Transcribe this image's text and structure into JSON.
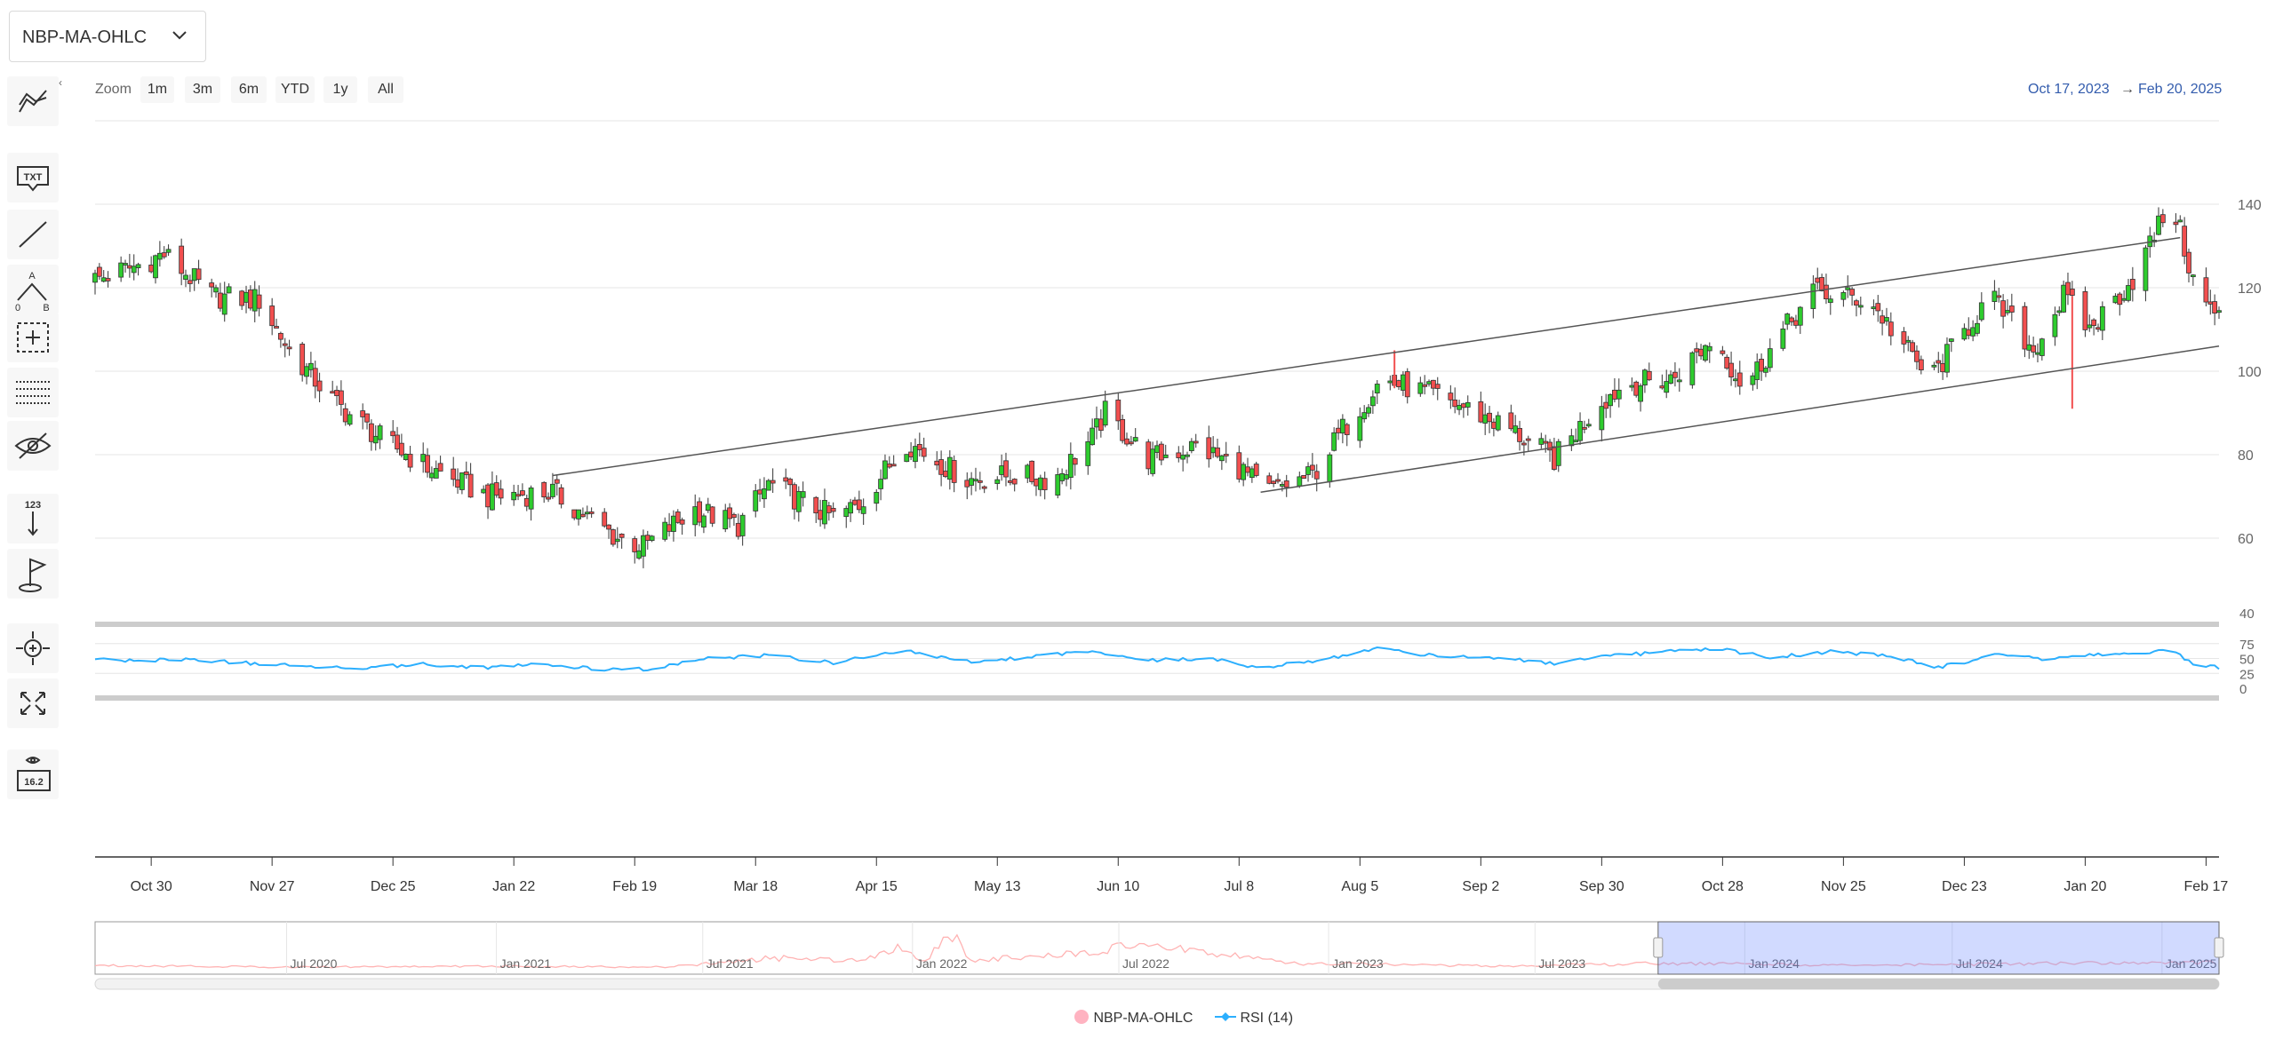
{
  "selector": {
    "value": "NBP-MA-OHLC"
  },
  "toolbar": {
    "collapse_glyph": "‹",
    "tools": [
      {
        "name": "indicators-icon"
      },
      {
        "name": "text-annotation-icon",
        "text": "TXT"
      },
      {
        "name": "line-tool-icon"
      },
      {
        "name": "elliott-wave-icon",
        "texts": [
          "A",
          "0",
          "B"
        ]
      },
      {
        "name": "crosshair-measure-icon"
      },
      {
        "name": "fibonacci-retracement-icon"
      },
      {
        "name": "hide-drawings-icon"
      },
      {
        "name": "vertical-counter-icon",
        "text": "123"
      },
      {
        "name": "flag-icon"
      },
      {
        "name": "zoom-change-icon"
      },
      {
        "name": "fullscreen-icon"
      },
      {
        "name": "current-price-icon",
        "text": "16.2"
      }
    ]
  },
  "zoom": {
    "label": "Zoom",
    "buttons": [
      "1m",
      "3m",
      "6m",
      "YTD",
      "1y",
      "All"
    ]
  },
  "range": {
    "from": "Oct 17, 2023",
    "arrow": "→",
    "to": "Feb 20, 2025"
  },
  "legend": {
    "ohlc": "NBP-MA-OHLC",
    "rsi": "RSI (14)"
  },
  "colors": {
    "up": "#2ecc2e",
    "down": "#f24f4f",
    "rsi": "#2caffe",
    "navigator_line": "#ffb3b3",
    "navigator_mask": "rgba(102,133,255,0.3)",
    "range_text": "#335cad"
  },
  "chart_data": [
    {
      "type": "candlestick",
      "x_ticks": [
        "Oct 30",
        "Nov 27",
        "Dec 25",
        "Jan 22",
        "Feb 19",
        "Mar 18",
        "Apr 15",
        "May 13",
        "Jun 10",
        "Jul 8",
        "Aug 5",
        "Sep 2",
        "Sep 30",
        "Oct 28",
        "Nov 25",
        "Dec 23",
        "Jan 20",
        "Feb 17"
      ],
      "y_ticks": [
        60,
        80,
        100,
        120,
        140
      ],
      "ylim": [
        40,
        160
      ],
      "x_range": [
        "2023-10-17",
        "2025-02-20"
      ],
      "close_path": [
        [
          "2023-10-17",
          122
        ],
        [
          "2023-10-26",
          125
        ],
        [
          "2023-11-02",
          128
        ],
        [
          "2023-11-13",
          118
        ],
        [
          "2023-11-24",
          117
        ],
        [
          "2023-12-01",
          105
        ],
        [
          "2023-12-12",
          92
        ],
        [
          "2023-12-22",
          84
        ],
        [
          "2024-01-02",
          77
        ],
        [
          "2024-01-16",
          70
        ],
        [
          "2024-01-31",
          71
        ],
        [
          "2024-02-15",
          60
        ],
        [
          "2024-02-21",
          58
        ],
        [
          "2024-03-04",
          67
        ],
        [
          "2024-03-14",
          63
        ],
        [
          "2024-03-21",
          73
        ],
        [
          "2024-04-05",
          65
        ],
        [
          "2024-04-11",
          68
        ],
        [
          "2024-04-22",
          83
        ],
        [
          "2024-05-06",
          74
        ],
        [
          "2024-05-16",
          75
        ],
        [
          "2024-05-26",
          74
        ],
        [
          "2024-06-04",
          84
        ],
        [
          "2024-06-07",
          90
        ],
        [
          "2024-06-17",
          79
        ],
        [
          "2024-06-28",
          82
        ],
        [
          "2024-07-08",
          77
        ],
        [
          "2024-07-14",
          71
        ],
        [
          "2024-07-25",
          75
        ],
        [
          "2024-08-01",
          86
        ],
        [
          "2024-08-10",
          98
        ],
        [
          "2024-08-20",
          95
        ],
        [
          "2024-08-30",
          91
        ],
        [
          "2024-09-09",
          86
        ],
        [
          "2024-09-19",
          79
        ],
        [
          "2024-09-30",
          93
        ],
        [
          "2024-10-06",
          97
        ],
        [
          "2024-10-16",
          98
        ],
        [
          "2024-10-26",
          108
        ],
        [
          "2024-11-02",
          96
        ],
        [
          "2024-11-10",
          108
        ],
        [
          "2024-11-18",
          119
        ],
        [
          "2024-12-01",
          117
        ],
        [
          "2024-12-15",
          98
        ],
        [
          "2024-12-29",
          118
        ],
        [
          "2025-01-08",
          105
        ],
        [
          "2025-01-15",
          118
        ],
        [
          "2025-01-21",
          110
        ],
        [
          "2025-01-31",
          122
        ],
        [
          "2025-02-09",
          141
        ],
        [
          "2025-02-15",
          118
        ],
        [
          "2025-02-20",
          113
        ]
      ],
      "trend_channel": {
        "upper": [
          [
            "2024-01-31",
            75
          ],
          [
            "2025-02-11",
            132
          ]
        ],
        "lower": [
          [
            "2024-07-13",
            71
          ],
          [
            "2025-02-20",
            106
          ]
        ]
      },
      "outlier_wicks": [
        {
          "date": "2024-08-13",
          "high": 105,
          "low": 96
        },
        {
          "date": "2025-01-17",
          "high": 118,
          "low": 91
        }
      ]
    },
    {
      "type": "line",
      "series": [
        {
          "name": "RSI (14)",
          "ylim": [
            0,
            100
          ],
          "y_ticks": [
            0,
            25,
            50,
            75,
            40
          ]
        }
      ],
      "rsi_path": [
        [
          "2023-10-17",
          48
        ],
        [
          "2023-10-27",
          46
        ],
        [
          "2023-11-06",
          49
        ],
        [
          "2023-11-17",
          44
        ],
        [
          "2023-12-01",
          38
        ],
        [
          "2023-12-15",
          34
        ],
        [
          "2024-01-01",
          40
        ],
        [
          "2024-01-15",
          35
        ],
        [
          "2024-01-29",
          40
        ],
        [
          "2024-02-12",
          31
        ],
        [
          "2024-02-22",
          32
        ],
        [
          "2024-03-07",
          50
        ],
        [
          "2024-03-21",
          55
        ],
        [
          "2024-04-05",
          43
        ],
        [
          "2024-04-21",
          63
        ],
        [
          "2024-05-06",
          45
        ],
        [
          "2024-05-20",
          52
        ],
        [
          "2024-06-03",
          63
        ],
        [
          "2024-06-17",
          47
        ],
        [
          "2024-07-01",
          50
        ],
        [
          "2024-07-12",
          35
        ],
        [
          "2024-07-25",
          44
        ],
        [
          "2024-08-09",
          68
        ],
        [
          "2024-08-20",
          56
        ],
        [
          "2024-09-04",
          52
        ],
        [
          "2024-09-19",
          41
        ],
        [
          "2024-10-03",
          55
        ],
        [
          "2024-10-17",
          62
        ],
        [
          "2024-10-28",
          66
        ],
        [
          "2024-11-08",
          51
        ],
        [
          "2024-11-22",
          62
        ],
        [
          "2024-12-06",
          54
        ],
        [
          "2024-12-17",
          35
        ],
        [
          "2025-01-01",
          58
        ],
        [
          "2025-01-12",
          48
        ],
        [
          "2025-01-21",
          55
        ],
        [
          "2025-02-02",
          60
        ],
        [
          "2025-02-09",
          63
        ],
        [
          "2025-02-15",
          38
        ],
        [
          "2025-02-20",
          35
        ]
      ]
    },
    {
      "type": "area",
      "name": "navigator",
      "x_ticks": [
        "Jul 2020",
        "Jan 2021",
        "Jul 2021",
        "Jan 2022",
        "Jul 2022",
        "Jan 2023",
        "Jul 2023",
        "Jan 2024",
        "Jul 2024",
        "Jan 2025"
      ],
      "selected_range": [
        "2023-10-17",
        "2025-02-20"
      ]
    }
  ]
}
